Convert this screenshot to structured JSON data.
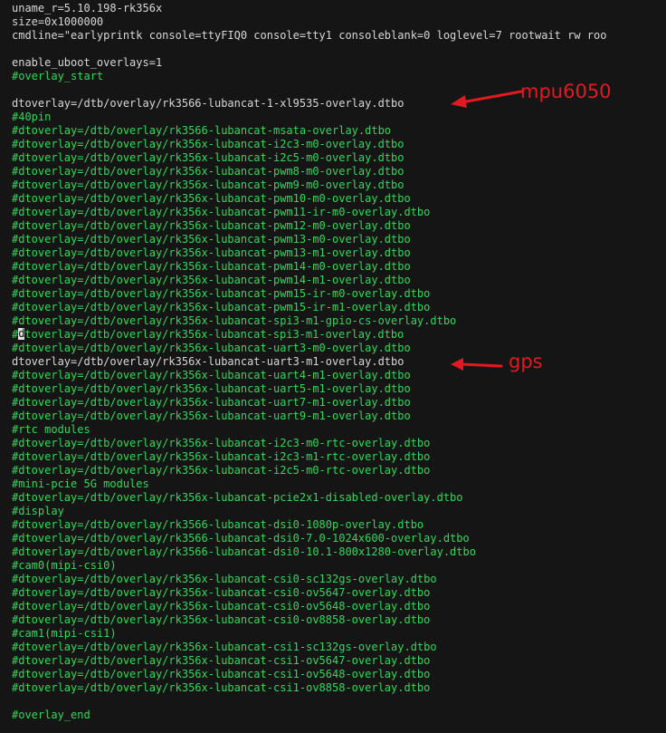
{
  "lines": [
    {
      "text": "uname_r=5.10.198-rk356x",
      "kind": "plain"
    },
    {
      "text": "size=0x1000000",
      "kind": "plain"
    },
    {
      "text": "cmdline=\"earlyprintk console=ttyFIQ0 console=tty1 consoleblank=0 loglevel=7 rootwait rw roo",
      "kind": "plain"
    },
    {
      "text": "",
      "kind": "plain"
    },
    {
      "text": "enable_uboot_overlays=1",
      "kind": "plain"
    },
    {
      "text": "#overlay_start",
      "kind": "comment"
    },
    {
      "text": "",
      "kind": "plain"
    },
    {
      "text": "dtoverlay=/dtb/overlay/rk3566-lubancat-1-xl9535-overlay.dtbo",
      "kind": "plain"
    },
    {
      "text": "#40pin",
      "kind": "comment"
    },
    {
      "text": "#dtoverlay=/dtb/overlay/rk3566-lubancat-msata-overlay.dtbo",
      "kind": "comment"
    },
    {
      "text": "#dtoverlay=/dtb/overlay/rk356x-lubancat-i2c3-m0-overlay.dtbo",
      "kind": "comment"
    },
    {
      "text": "#dtoverlay=/dtb/overlay/rk356x-lubancat-i2c5-m0-overlay.dtbo",
      "kind": "comment"
    },
    {
      "text": "#dtoverlay=/dtb/overlay/rk356x-lubancat-pwm8-m0-overlay.dtbo",
      "kind": "comment"
    },
    {
      "text": "#dtoverlay=/dtb/overlay/rk356x-lubancat-pwm9-m0-overlay.dtbo",
      "kind": "comment"
    },
    {
      "text": "#dtoverlay=/dtb/overlay/rk356x-lubancat-pwm10-m0-overlay.dtbo",
      "kind": "comment"
    },
    {
      "text": "#dtoverlay=/dtb/overlay/rk356x-lubancat-pwm11-ir-m0-overlay.dtbo",
      "kind": "comment"
    },
    {
      "text": "#dtoverlay=/dtb/overlay/rk356x-lubancat-pwm12-m0-overlay.dtbo",
      "kind": "comment"
    },
    {
      "text": "#dtoverlay=/dtb/overlay/rk356x-lubancat-pwm13-m0-overlay.dtbo",
      "kind": "comment"
    },
    {
      "text": "#dtoverlay=/dtb/overlay/rk356x-lubancat-pwm13-m1-overlay.dtbo",
      "kind": "comment"
    },
    {
      "text": "#dtoverlay=/dtb/overlay/rk356x-lubancat-pwm14-m0-overlay.dtbo",
      "kind": "comment"
    },
    {
      "text": "#dtoverlay=/dtb/overlay/rk356x-lubancat-pwm14-m1-overlay.dtbo",
      "kind": "comment"
    },
    {
      "text": "#dtoverlay=/dtb/overlay/rk356x-lubancat-pwm15-ir-m0-overlay.dtbo",
      "kind": "comment"
    },
    {
      "text": "#dtoverlay=/dtb/overlay/rk356x-lubancat-pwm15-ir-m1-overlay.dtbo",
      "kind": "comment"
    },
    {
      "text": "#dtoverlay=/dtb/overlay/rk356x-lubancat-spi3-m1-gpio-cs-overlay.dtbo",
      "kind": "comment"
    },
    {
      "text": "#dtoverlay=/dtb/overlay/rk356x-lubancat-spi3-m1-overlay.dtbo",
      "kind": "comment",
      "cursor_after": 1
    },
    {
      "text": "#dtoverlay=/dtb/overlay/rk356x-lubancat-uart3-m0-overlay.dtbo",
      "kind": "comment"
    },
    {
      "text": "dtoverlay=/dtb/overlay/rk356x-lubancat-uart3-m1-overlay.dtbo",
      "kind": "plain"
    },
    {
      "text": "#dtoverlay=/dtb/overlay/rk356x-lubancat-uart4-m1-overlay.dtbo",
      "kind": "comment"
    },
    {
      "text": "#dtoverlay=/dtb/overlay/rk356x-lubancat-uart5-m1-overlay.dtbo",
      "kind": "comment"
    },
    {
      "text": "#dtoverlay=/dtb/overlay/rk356x-lubancat-uart7-m1-overlay.dtbo",
      "kind": "comment"
    },
    {
      "text": "#dtoverlay=/dtb/overlay/rk356x-lubancat-uart9-m1-overlay.dtbo",
      "kind": "comment"
    },
    {
      "text": "#rtc modules",
      "kind": "comment"
    },
    {
      "text": "#dtoverlay=/dtb/overlay/rk356x-lubancat-i2c3-m0-rtc-overlay.dtbo",
      "kind": "comment"
    },
    {
      "text": "#dtoverlay=/dtb/overlay/rk356x-lubancat-i2c3-m1-rtc-overlay.dtbo",
      "kind": "comment"
    },
    {
      "text": "#dtoverlay=/dtb/overlay/rk356x-lubancat-i2c5-m0-rtc-overlay.dtbo",
      "kind": "comment"
    },
    {
      "text": "#mini-pcie 5G modules",
      "kind": "comment"
    },
    {
      "text": "#dtoverlay=/dtb/overlay/rk356x-lubancat-pcie2x1-disabled-overlay.dtbo",
      "kind": "comment"
    },
    {
      "text": "#display",
      "kind": "comment"
    },
    {
      "text": "#dtoverlay=/dtb/overlay/rk3566-lubancat-dsi0-1080p-overlay.dtbo",
      "kind": "comment"
    },
    {
      "text": "#dtoverlay=/dtb/overlay/rk3566-lubancat-dsi0-7.0-1024x600-overlay.dtbo",
      "kind": "comment"
    },
    {
      "text": "#dtoverlay=/dtb/overlay/rk3566-lubancat-dsi0-10.1-800x1280-overlay.dtbo",
      "kind": "comment"
    },
    {
      "text": "#cam0(mipi-csi0)",
      "kind": "comment"
    },
    {
      "text": "#dtoverlay=/dtb/overlay/rk356x-lubancat-csi0-sc132gs-overlay.dtbo",
      "kind": "comment"
    },
    {
      "text": "#dtoverlay=/dtb/overlay/rk356x-lubancat-csi0-ov5647-overlay.dtbo",
      "kind": "comment"
    },
    {
      "text": "#dtoverlay=/dtb/overlay/rk356x-lubancat-csi0-ov5648-overlay.dtbo",
      "kind": "comment"
    },
    {
      "text": "#dtoverlay=/dtb/overlay/rk356x-lubancat-csi0-ov8858-overlay.dtbo",
      "kind": "comment"
    },
    {
      "text": "#cam1(mipi-csi1)",
      "kind": "comment"
    },
    {
      "text": "#dtoverlay=/dtb/overlay/rk356x-lubancat-csi1-sc132gs-overlay.dtbo",
      "kind": "comment"
    },
    {
      "text": "#dtoverlay=/dtb/overlay/rk356x-lubancat-csi1-ov5647-overlay.dtbo",
      "kind": "comment"
    },
    {
      "text": "#dtoverlay=/dtb/overlay/rk356x-lubancat-csi1-ov5648-overlay.dtbo",
      "kind": "comment"
    },
    {
      "text": "#dtoverlay=/dtb/overlay/rk356x-lubancat-csi1-ov8858-overlay.dtbo",
      "kind": "comment"
    },
    {
      "text": "",
      "kind": "plain"
    },
    {
      "text": "#overlay_end",
      "kind": "comment"
    }
  ],
  "annotations": {
    "mpu_label": "mpu6050",
    "gps_label": "gps",
    "color": "#e11a22"
  },
  "colors": {
    "background": "#151515",
    "plain_text": "#d7d7d7",
    "comment_text": "#2fd85a"
  }
}
